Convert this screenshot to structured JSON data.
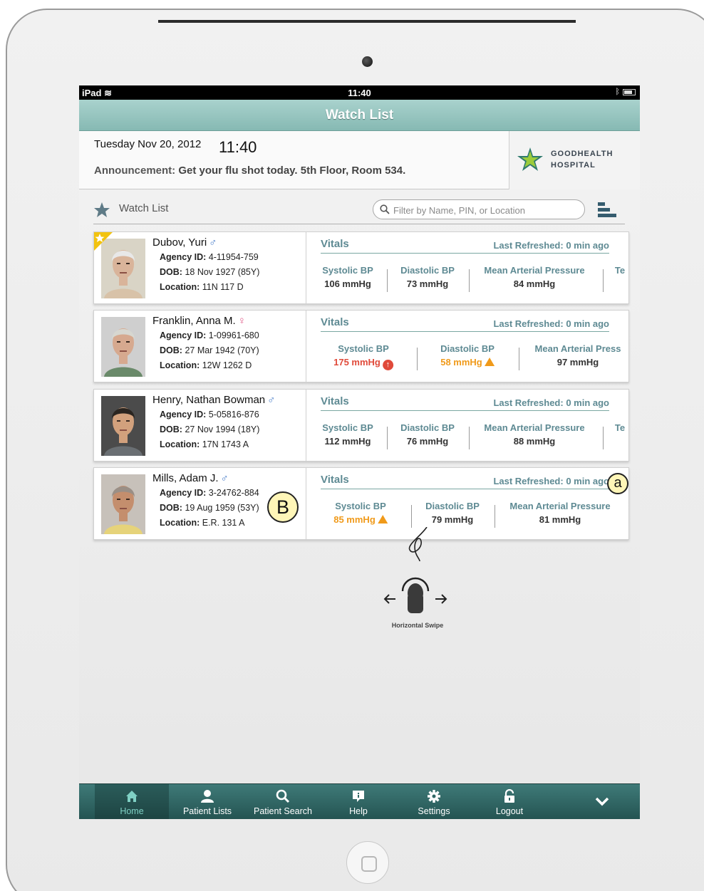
{
  "status_bar": {
    "device": "iPad",
    "time": "11:40"
  },
  "app": {
    "title": "Watch List"
  },
  "header": {
    "date": "Tuesday Nov 20, 2012",
    "time": "11:40",
    "announcement_label": "Announcement:",
    "announcement_text": "Get your flu shot today.  5th Floor, Room 534.",
    "hospital_line1": "GOODHEALTH",
    "hospital_line2": "HOSPITAL"
  },
  "watchlist": {
    "title": "Watch List",
    "search_placeholder": "Filter by Name, PIN, or Location"
  },
  "patients": [
    {
      "name": "Dubov, Yuri",
      "gender": "♂",
      "agency_label": "Agency ID:",
      "agency_id": "4-11954-759",
      "dob_label": "DOB:",
      "dob": "18 Nov 1927 (85Y)",
      "location_label": "Location:",
      "location": "11N 117 D",
      "vitals_title": "Vitals",
      "refreshed": "Last Refreshed: 0 min ago",
      "vitals": [
        {
          "label": "Systolic BP",
          "value": "106 mmHg"
        },
        {
          "label": "Diastolic BP",
          "value": "73 mmHg"
        },
        {
          "label": "Mean Arterial Pressure",
          "value": "84 mmHg"
        },
        {
          "label": "Te",
          "value": ""
        }
      ]
    },
    {
      "name": "Franklin, Anna M.",
      "gender": "♀",
      "agency_label": "Agency ID:",
      "agency_id": "1-09961-680",
      "dob_label": "DOB:",
      "dob": "27 Mar 1942 (70Y)",
      "location_label": "Location:",
      "location": "12W 1262 D",
      "vitals_title": "Vitals",
      "refreshed": "Last Refreshed: 0 min ago",
      "vitals": [
        {
          "label": "Systolic BP",
          "value": "175 mmHg",
          "status": "high"
        },
        {
          "label": "Diastolic BP",
          "value": "58 mmHg",
          "status": "warning"
        },
        {
          "label": "Mean Arterial Press",
          "value": "97 mmHg"
        }
      ]
    },
    {
      "name": "Henry, Nathan Bowman",
      "gender": "♂",
      "agency_label": "Agency ID:",
      "agency_id": "5-05816-876",
      "dob_label": "DOB:",
      "dob": "27 Nov 1994 (18Y)",
      "location_label": "Location:",
      "location": "17N 1743 A",
      "vitals_title": "Vitals",
      "refreshed": "Last Refreshed: 0 min ago",
      "vitals": [
        {
          "label": "Systolic BP",
          "value": "112 mmHg"
        },
        {
          "label": "Diastolic BP",
          "value": "76 mmHg"
        },
        {
          "label": "Mean Arterial Pressure",
          "value": "88 mmHg"
        },
        {
          "label": "Te",
          "value": ""
        }
      ]
    },
    {
      "name": "Mills, Adam J.",
      "gender": "♂",
      "agency_label": "Agency ID:",
      "agency_id": "3-24762-884",
      "dob_label": "DOB:",
      "dob": "19 Aug 1959 (53Y)",
      "location_label": "Location:",
      "location": "E.R. 131 A",
      "vitals_title": "Vitals",
      "refreshed": "Last Refreshed: 0 min ago",
      "vitals": [
        {
          "label": "Systolic BP",
          "value": "85 mmHg",
          "status": "warning"
        },
        {
          "label": "Diastolic BP",
          "value": "79 mmHg"
        },
        {
          "label": "Mean Arterial Pressure",
          "value": "81 mmHg"
        }
      ]
    }
  ],
  "annotations": {
    "callout_a": "a",
    "callout_b": "B",
    "gesture_label": "Horizontal Swipe"
  },
  "tabs": [
    {
      "label": "Home",
      "icon": "home-icon"
    },
    {
      "label": "Patient Lists",
      "icon": "person-icon"
    },
    {
      "label": "Patient Search",
      "icon": "search-icon"
    },
    {
      "label": "Help",
      "icon": "help-icon"
    },
    {
      "label": "Settings",
      "icon": "gear-icon"
    },
    {
      "label": "Logout",
      "icon": "lock-icon"
    }
  ],
  "colors": {
    "accent": "#5e8a93",
    "tabbar": "#2f6664",
    "alert_red": "#e04a3a",
    "alert_orange": "#f09a1a"
  }
}
